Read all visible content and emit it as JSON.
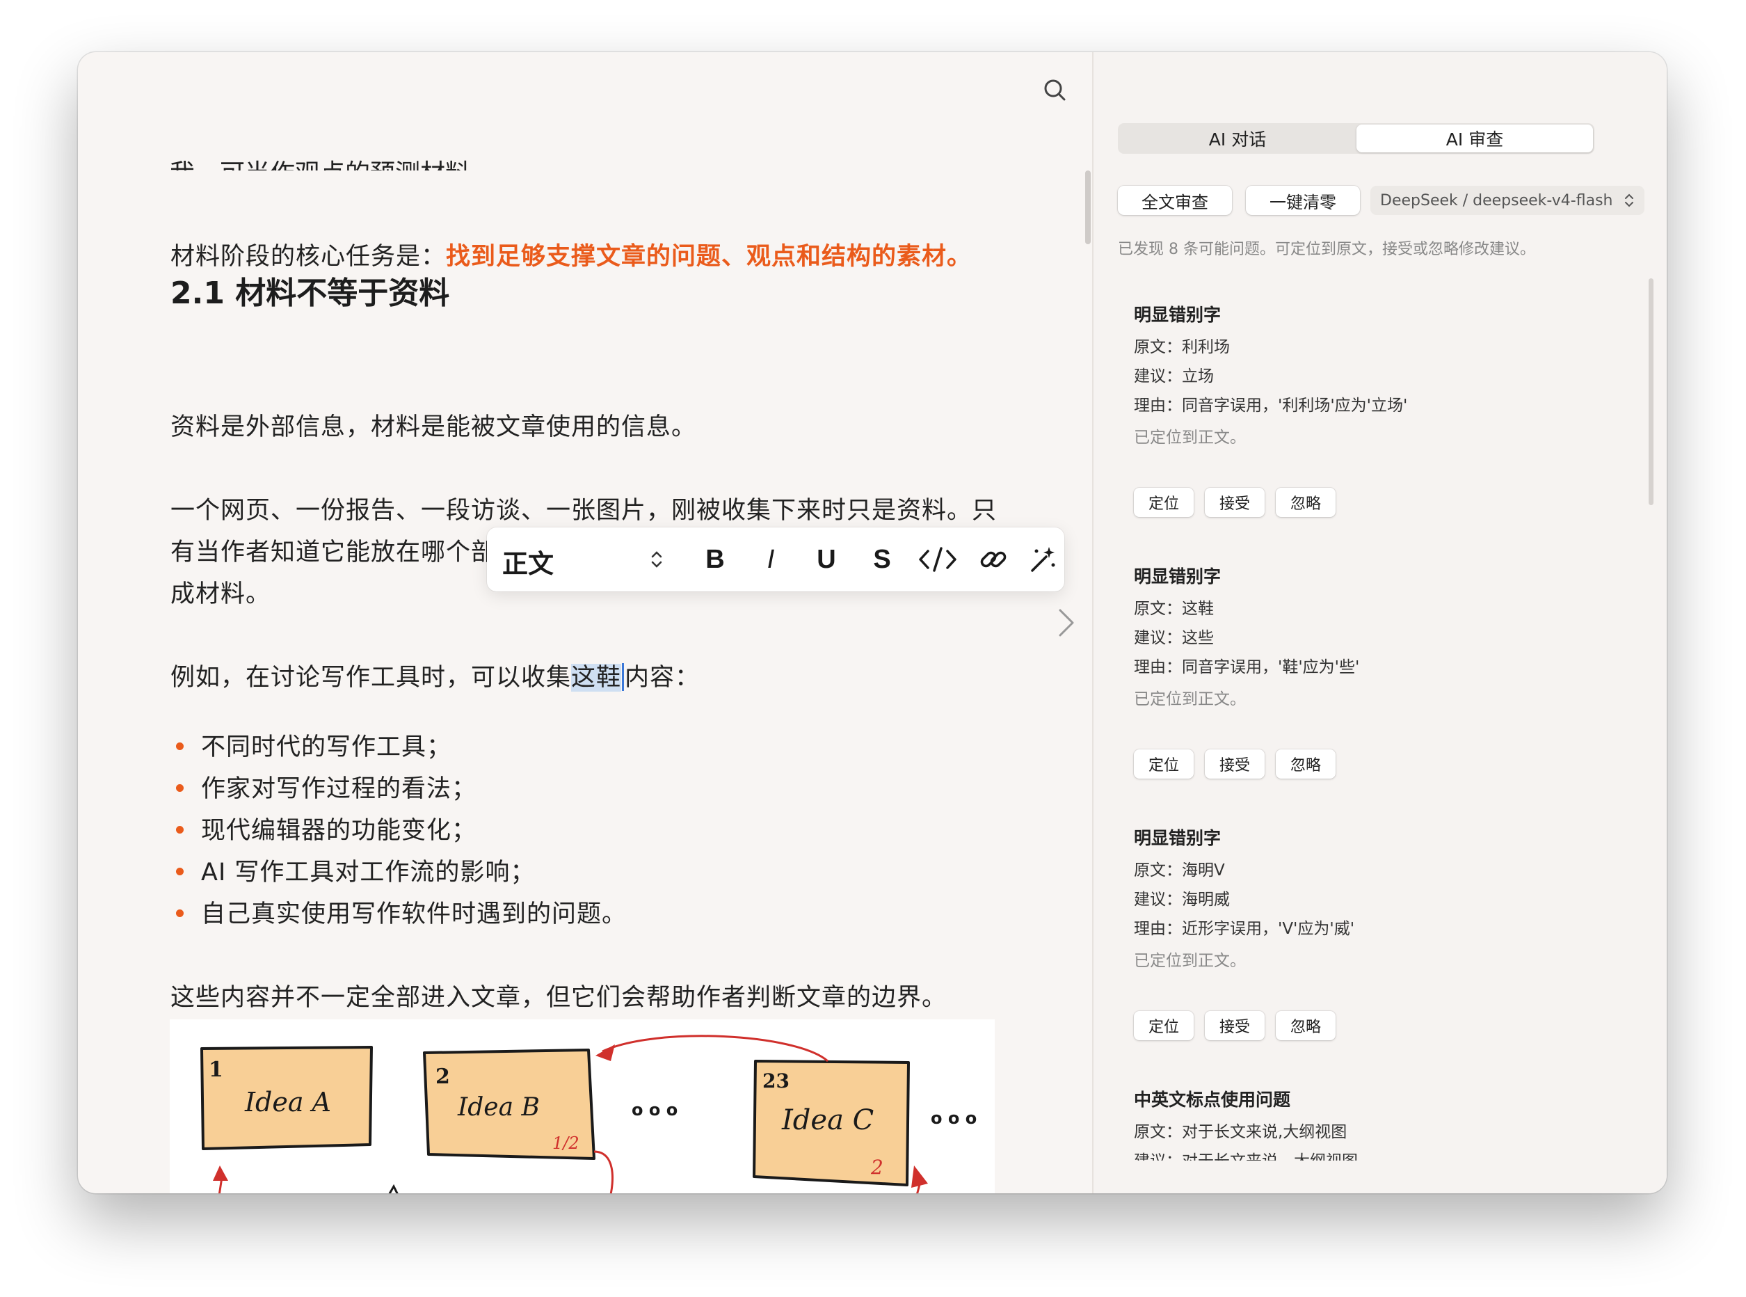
{
  "editor": {
    "cut_line": "我，可当作观点的预测材料。",
    "p1_prefix": "材料阶段的核心任务是：",
    "p1_highlight": "找到足够支撑文章的问题、观点和结构的素材。",
    "heading": "2.1 材料不等于资料",
    "p2": "资料是外部信息，材料是能被文章使用的信息。",
    "p3_line1": "一个网页、一份报告、一段访谈、一张图片，刚被收集下来时只是资料。只",
    "p3_line2": "有当作者知道它能放在哪个部分、说明哪个问题、支持哪个判断时，它才变",
    "p3_line3": "成材料。",
    "p4_before": "例如，在讨论写作工具时，可以收集",
    "p4_selected": "这鞋",
    "p4_after": "内容：",
    "bullets": [
      "不同时代的写作工具；",
      "作家对写作过程的看法；",
      "现代编辑器的功能变化；",
      "AI 写作工具对工作流的影响；",
      "自己真实使用写作软件时遇到的问题。"
    ],
    "p5": "这些内容并不一定全部进入文章，但它们会帮助作者判断文章的边界。",
    "accent_color": "#ea5b1b"
  },
  "toolbar": {
    "style_label": "正文",
    "bold": "B",
    "italic": "I",
    "underline": "U",
    "strike": "S"
  },
  "sketch": {
    "cards": [
      {
        "num": "1",
        "label": "Idea A",
        "sub": ""
      },
      {
        "num": "2",
        "label": "Idea B",
        "sub": "1/2"
      },
      {
        "num": "23",
        "label": "Idea C",
        "sub": "2"
      }
    ],
    "ellipsis": "o o o"
  },
  "sidebar": {
    "tabs": [
      {
        "label": "AI 对话",
        "active": false
      },
      {
        "label": "AI 审查",
        "active": true
      }
    ],
    "full_review_label": "全文审查",
    "clear_label": "一键清零",
    "model_label": "DeepSeek / deepseek-v4-flash",
    "summary": "已发现 8 条可能问题。可定位到原文，接受或忽略修改建议。",
    "issues": [
      {
        "title": "明显错别字",
        "original": "原文：利利场",
        "suggestion": "建议：立场",
        "reason": "理由：同音字误用，'利利场'应为'立场'",
        "status": "已定位到正文。"
      },
      {
        "title": "明显错别字",
        "original": "原文：这鞋",
        "suggestion": "建议：这些",
        "reason": "理由：同音字误用，'鞋'应为'些'",
        "status": "已定位到正文。"
      },
      {
        "title": "明显错别字",
        "original": "原文：海明V",
        "suggestion": "建议：海明威",
        "reason": "理由：近形字误用，'V'应为'威'",
        "status": "已定位到正文。"
      },
      {
        "title": "中英文标点使用问题",
        "original": "原文：对于长文来说,大纲视图",
        "suggestion": "建议：对于长文来说，大纲视图",
        "reason": "",
        "status": ""
      }
    ],
    "action_labels": {
      "locate": "定位",
      "accept": "接受",
      "ignore": "忽略"
    }
  }
}
